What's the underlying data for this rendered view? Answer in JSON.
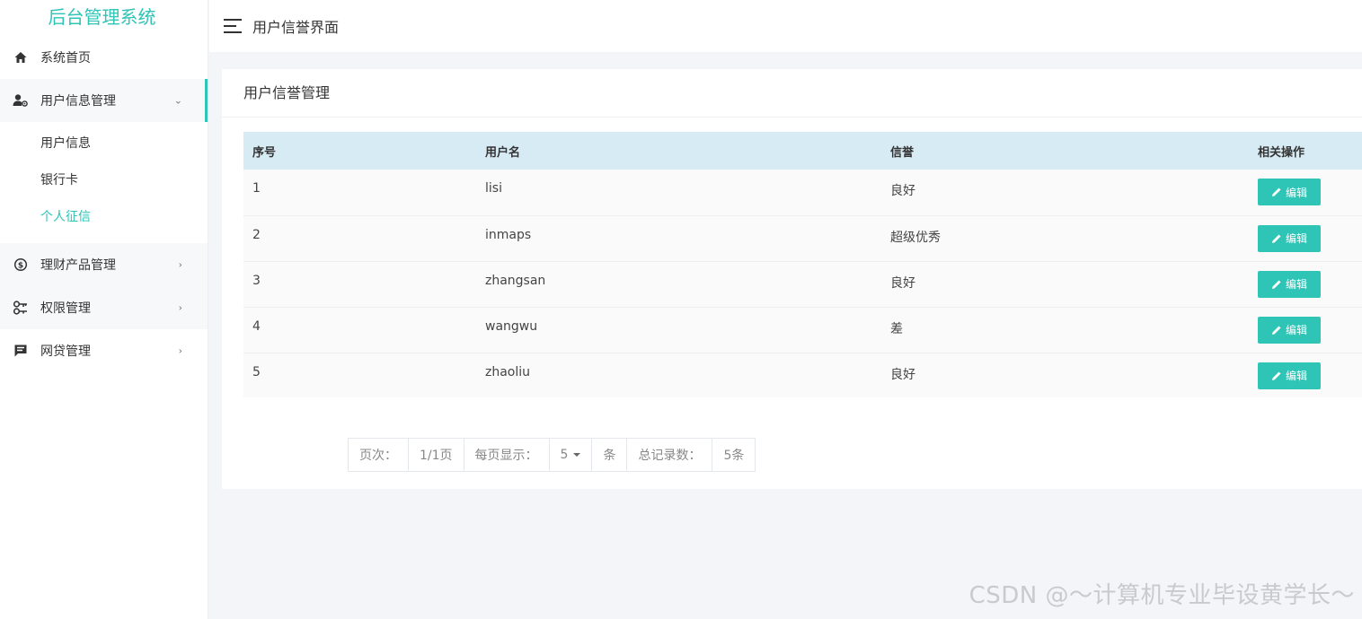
{
  "sidebar": {
    "logo": "后台管理系统",
    "items": [
      {
        "label": "系统首页",
        "icon": "home-icon"
      },
      {
        "label": "用户信息管理",
        "icon": "user-settings-icon",
        "arrow": "⌄"
      },
      {
        "label": "理财产品管理",
        "icon": "dollar-circle-icon",
        "arrow": "›"
      },
      {
        "label": "权限管理",
        "icon": "key-icon",
        "arrow": "›"
      },
      {
        "label": "网贷管理",
        "icon": "message-icon",
        "arrow": "›"
      }
    ],
    "sub_items": [
      "用户信息",
      "银行卡",
      "个人征信"
    ]
  },
  "header": {
    "title": "用户信誉界面"
  },
  "card": {
    "title": "用户信誉管理",
    "columns": [
      "序号",
      "用户名",
      "信誉",
      "相关操作"
    ],
    "rows": [
      {
        "id": "1",
        "username": "lisi",
        "credit": "良好",
        "action": "编辑"
      },
      {
        "id": "2",
        "username": "inmaps",
        "credit": "超级优秀",
        "action": "编辑"
      },
      {
        "id": "3",
        "username": "zhangsan",
        "credit": "良好",
        "action": "编辑"
      },
      {
        "id": "4",
        "username": "wangwu",
        "credit": "差",
        "action": "编辑"
      },
      {
        "id": "5",
        "username": "zhaoliu",
        "credit": "良好",
        "action": "编辑"
      }
    ]
  },
  "pager": {
    "page_label": "页次：",
    "page_value": "1/1页",
    "per_page_label": "每页显示：",
    "per_page_value": "5",
    "unit": "条",
    "total_label": "总记录数：",
    "total_value": "5条"
  },
  "watermark": "CSDN @～计算机专业毕设黄学长～",
  "colors": {
    "accent": "#2ec4b6",
    "table_header": "#d7ebf5",
    "background": "#f3f5f9"
  }
}
